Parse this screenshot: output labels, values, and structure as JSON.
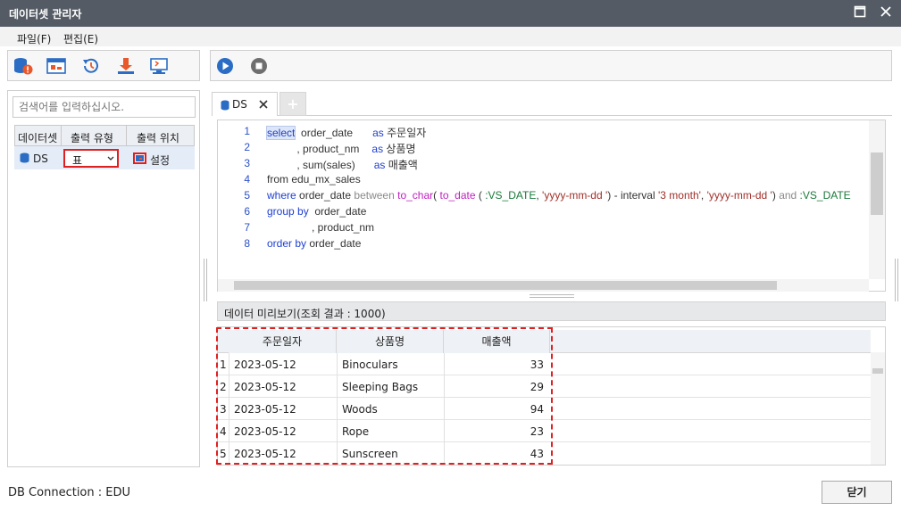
{
  "window": {
    "title": "데이터셋 관리자"
  },
  "menu": {
    "file": "파일(F)",
    "edit": "편집(E)"
  },
  "search": {
    "placeholder": "검색어를 입력하십시오."
  },
  "dataset_grid": {
    "headers": [
      "데이터셋",
      "출력 유형",
      "출력 위치"
    ],
    "rows": [
      {
        "name": "DS",
        "type": "표",
        "location": "설정"
      }
    ]
  },
  "tab": {
    "label": "DS"
  },
  "code": {
    "lines": [
      "1",
      "2",
      "3",
      "4",
      "5",
      "6",
      "7",
      "8"
    ],
    "l1": {
      "kw": "select",
      "rest": "  order_date",
      "as": "as",
      "alias": "주문일자"
    },
    "l2": {
      "rest": "          , product_nm",
      "as": "as",
      "alias": "상품명"
    },
    "l3": {
      "rest": "          , sum(sales)",
      "as": "as",
      "alias": "매출액"
    },
    "l4": {
      "text": "from edu_mx_sales"
    },
    "l5": {
      "kw": "where",
      "a": " order_date ",
      "between": "between",
      "fn1": "to_char",
      "p1": "( ",
      "fn2": "to_date",
      "p2": " ( ",
      "var1": ":VS_DATE",
      "p3": ", ",
      "s1": "'yyyy-mm-dd '",
      "p4": ") - interval ",
      "s2": "'3 month'",
      "p5": ", ",
      "s3": "'yyyy-mm-dd '",
      "p6": ") ",
      "and": "and",
      "var2": " :VS_DATE"
    },
    "l6": {
      "kw": "group by",
      "rest": "  order_date"
    },
    "l7": {
      "rest": "               , product_nm"
    },
    "l8": {
      "kw": "order by",
      "rest": " order_date"
    }
  },
  "preview": {
    "label": "데이터 미리보기(조회 결과 : 1000)"
  },
  "data_grid": {
    "headers": [
      "주문일자",
      "상품명",
      "매출액"
    ],
    "rows": [
      {
        "n": "1",
        "date": "2023-05-12",
        "product": "Binoculars",
        "sales": "33"
      },
      {
        "n": "2",
        "date": "2023-05-12",
        "product": "Sleeping Bags",
        "sales": "29"
      },
      {
        "n": "3",
        "date": "2023-05-12",
        "product": "Woods",
        "sales": "94"
      },
      {
        "n": "4",
        "date": "2023-05-12",
        "product": "Rope",
        "sales": "23"
      },
      {
        "n": "5",
        "date": "2023-05-12",
        "product": "Sunscreen",
        "sales": "43"
      }
    ]
  },
  "status": {
    "connection": "DB Connection : EDU"
  },
  "footer": {
    "close_label": "닫기"
  },
  "colors": {
    "titlebar": "#545b64",
    "accent": "#2b6cc4",
    "highlight": "#e02020"
  }
}
